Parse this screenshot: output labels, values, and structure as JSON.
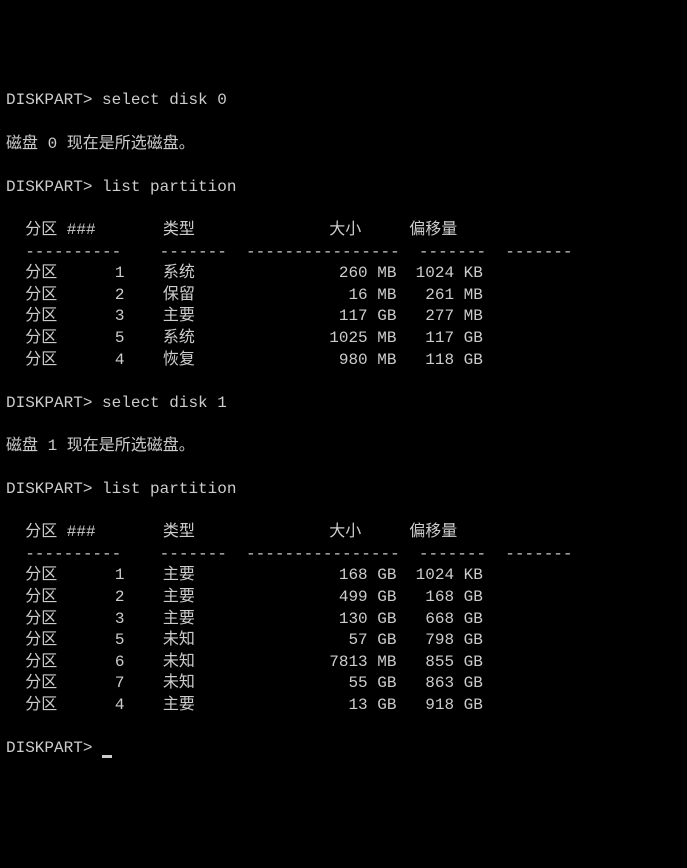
{
  "prompt": "DISKPART>",
  "cmd_select_disk0": "select disk 0",
  "msg_disk0_selected": "磁盘 0 现在是所选磁盘。",
  "cmd_list_partition": "list partition",
  "headers": {
    "partition": "分区 ###",
    "type": "类型",
    "size": "大小",
    "offset": "偏移量"
  },
  "dashes": {
    "c1": "----------",
    "c2": "-------",
    "c3": "----------------",
    "c4": "-------",
    "c5": "-------"
  },
  "disk0_rows": [
    {
      "label": "分区",
      "num": "1",
      "type": "系统",
      "size_val": "260",
      "size_unit": "MB",
      "off_val": "1024",
      "off_unit": "KB"
    },
    {
      "label": "分区",
      "num": "2",
      "type": "保留",
      "size_val": "16",
      "size_unit": "MB",
      "off_val": "261",
      "off_unit": "MB"
    },
    {
      "label": "分区",
      "num": "3",
      "type": "主要",
      "size_val": "117",
      "size_unit": "GB",
      "off_val": "277",
      "off_unit": "MB"
    },
    {
      "label": "分区",
      "num": "5",
      "type": "系统",
      "size_val": "1025",
      "size_unit": "MB",
      "off_val": "117",
      "off_unit": "GB"
    },
    {
      "label": "分区",
      "num": "4",
      "type": "恢复",
      "size_val": "980",
      "size_unit": "MB",
      "off_val": "118",
      "off_unit": "GB"
    }
  ],
  "cmd_select_disk1": "select disk 1",
  "msg_disk1_selected": "磁盘 1 现在是所选磁盘。",
  "disk1_rows": [
    {
      "label": "分区",
      "num": "1",
      "type": "主要",
      "size_val": "168",
      "size_unit": "GB",
      "off_val": "1024",
      "off_unit": "KB"
    },
    {
      "label": "分区",
      "num": "2",
      "type": "主要",
      "size_val": "499",
      "size_unit": "GB",
      "off_val": "168",
      "off_unit": "GB"
    },
    {
      "label": "分区",
      "num": "3",
      "type": "主要",
      "size_val": "130",
      "size_unit": "GB",
      "off_val": "668",
      "off_unit": "GB"
    },
    {
      "label": "分区",
      "num": "5",
      "type": "未知",
      "size_val": "57",
      "size_unit": "GB",
      "off_val": "798",
      "off_unit": "GB"
    },
    {
      "label": "分区",
      "num": "6",
      "type": "未知",
      "size_val": "7813",
      "size_unit": "MB",
      "off_val": "855",
      "off_unit": "GB"
    },
    {
      "label": "分区",
      "num": "7",
      "type": "未知",
      "size_val": "55",
      "size_unit": "GB",
      "off_val": "863",
      "off_unit": "GB"
    },
    {
      "label": "分区",
      "num": "4",
      "type": "主要",
      "size_val": "13",
      "size_unit": "GB",
      "off_val": "918",
      "off_unit": "GB"
    }
  ]
}
